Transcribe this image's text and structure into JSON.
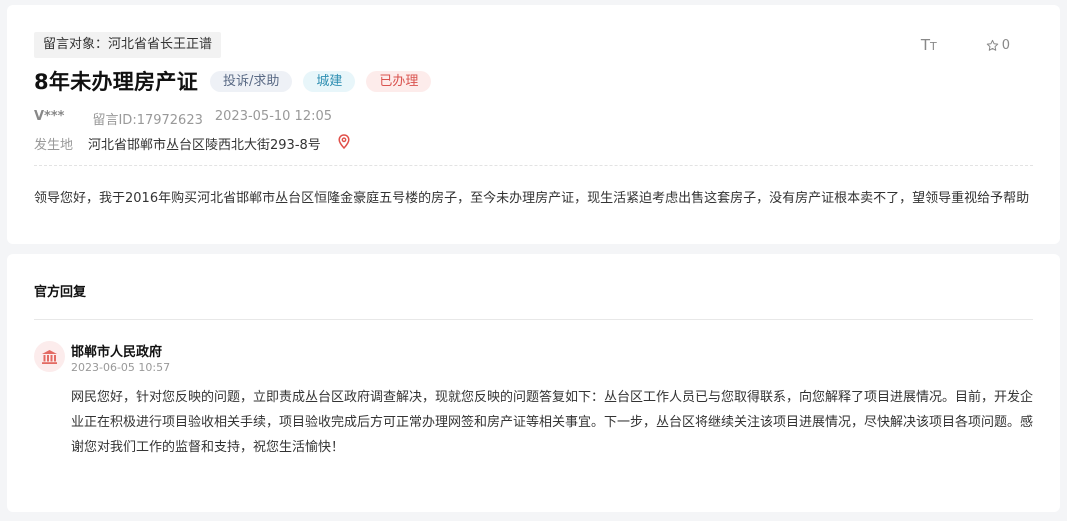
{
  "message": {
    "target": "留言对象：河北省省长王正谱",
    "title": "8年未办理房产证",
    "tags": {
      "type": "投诉/求助",
      "category": "城建",
      "status": "已办理"
    },
    "tools": {
      "font_size": "TT",
      "favorite_icon": "star-outline-icon",
      "favorite_count": "0"
    },
    "user": "V***",
    "message_id": "留言ID:17972623",
    "datetime": "2023-05-10 12:05",
    "location_label": "发生地",
    "location": "河北省邯郸市丛台区陵西北大街293-8号",
    "location_icon": "map-pin-icon",
    "content": "领导您好，我于2016年购买河北省邯郸市丛台区恒隆金豪庭五号楼的房子，至今未办理房产证，现生活紧迫考虑出售这套房子，没有房产证根本卖不了，望领导重视给予帮助"
  },
  "reply": {
    "heading": "官方回复",
    "avatar_icon": "government-building-icon",
    "org": "邯郸市人民政府",
    "datetime": "2023-06-05 10:57",
    "content": "网民您好，针对您反映的问题，立即责成丛台区政府调查解决，现就您反映的问题答复如下：丛台区工作人员已与您取得联系，向您解释了项目进展情况。目前，开发企业正在积极进行项目验收相关手续，项目验收完成后方可正常办理网签和房产证等相关事宜。下一步，丛台区将继续关注该项目进展情况，尽快解决该项目各项问题。感谢您对我们工作的监督和支持，祝您生活愉快！"
  },
  "colors": {
    "page_bg": "#f4f5f7",
    "status_red": "#d9534f",
    "category_blue": "#2f8fb2"
  }
}
